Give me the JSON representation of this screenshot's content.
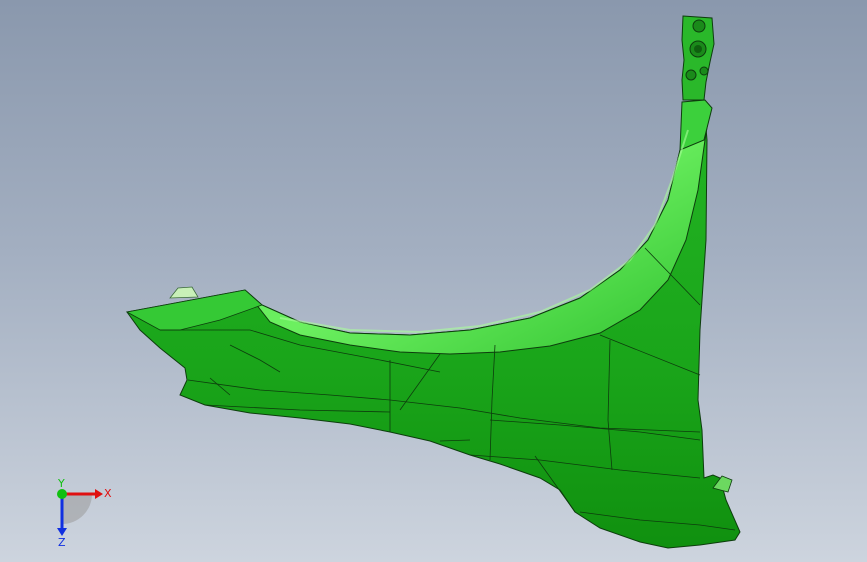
{
  "viewport": {
    "background_top": "#8a98ad",
    "background_bottom": "#cdd4de"
  },
  "model": {
    "part_color": "#1fb31f",
    "highlight_color": "#6cf060",
    "shadow_color": "#0c8a0c",
    "edge_color": "#0d3d0d"
  },
  "triad": {
    "x_label": "X",
    "y_label": "Y",
    "z_label": "Z",
    "x_color": "#e01010",
    "y_color": "#10c010",
    "z_color": "#1030e0"
  }
}
